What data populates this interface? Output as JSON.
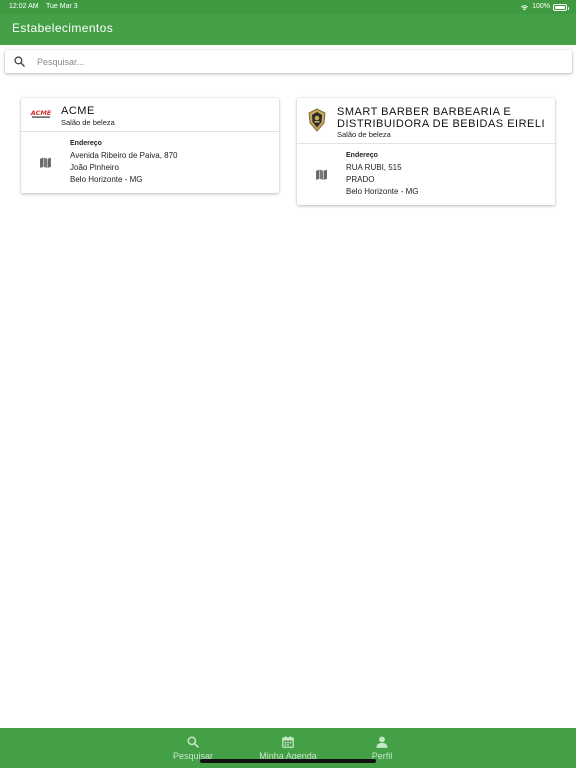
{
  "status_bar": {
    "time": "12:02 AM",
    "date": "Tue Mar 3",
    "battery": "100%"
  },
  "app_bar": {
    "title": "Estabelecimentos"
  },
  "search": {
    "placeholder": "Pesquisar...",
    "value": ""
  },
  "establishments": [
    {
      "name_lines": [
        "ACME"
      ],
      "category": "Salão de beleza",
      "logo_text": "ACME",
      "address_label": "Endereço",
      "address_lines": [
        "Avenida Ribeiro de Paiva, 870",
        "João Pinheiro",
        "Belo Horizonte - MG"
      ]
    },
    {
      "name_lines": [
        "SMART BARBER BARBEARIA E",
        "DISTRIBUIDORA DE BEBIDAS EIRELI"
      ],
      "category": "Salão de beleza",
      "address_label": "Endereço",
      "address_lines": [
        "RUA RUBI, 515",
        "PRADO",
        "Belo Horizonte - MG"
      ]
    }
  ],
  "bottom_nav": [
    {
      "label": "Pesquisar",
      "icon": "search-icon"
    },
    {
      "label": "Minha Agenda",
      "icon": "calendar-icon"
    },
    {
      "label": "Perfil",
      "icon": "person-icon"
    }
  ],
  "colors": {
    "primary": "#43a047",
    "status_bar": "#3f9a41",
    "nav_label": "#c8e6c9",
    "acme_red": "#d32f2f"
  }
}
